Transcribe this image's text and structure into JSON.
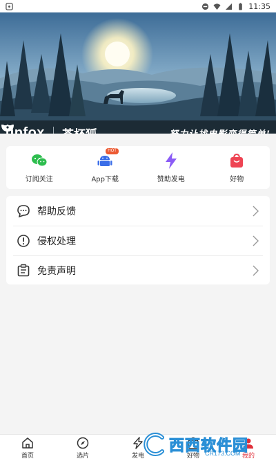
{
  "status_bar": {
    "time": "11:35"
  },
  "banner": {
    "logo_text": "upfox",
    "logo_cn": "茶杯狐",
    "slogan": "努力让找电影变得简单!"
  },
  "quick_actions": [
    {
      "label": "订阅关注",
      "icon": "wechat-icon",
      "color": "#2dbd4e"
    },
    {
      "label": "App下载",
      "icon": "android-icon",
      "color": "#3b6ee8",
      "badge": "HOT"
    },
    {
      "label": "赞助发电",
      "icon": "lightning-icon",
      "color": "#8b5cf6"
    },
    {
      "label": "好物",
      "icon": "shopping-bag-icon",
      "color": "#ee4453"
    }
  ],
  "menu": [
    {
      "label": "帮助反馈",
      "icon": "chat-bubble-icon"
    },
    {
      "label": "侵权处理",
      "icon": "alert-circle-icon"
    },
    {
      "label": "免责声明",
      "icon": "document-icon"
    }
  ],
  "bottom_nav": [
    {
      "label": "首页",
      "icon": "home-icon"
    },
    {
      "label": "选片",
      "icon": "compass-icon"
    },
    {
      "label": "发电",
      "icon": "lightning-icon"
    },
    {
      "label": "好物",
      "icon": "bag-icon"
    },
    {
      "label": "我的",
      "icon": "user-icon",
      "active": true
    }
  ],
  "watermark": {
    "text": "西西软件园",
    "sub": "CR173.COM"
  },
  "colors": {
    "accent": "#e0303a",
    "banner_dark": "#1c2b35"
  }
}
